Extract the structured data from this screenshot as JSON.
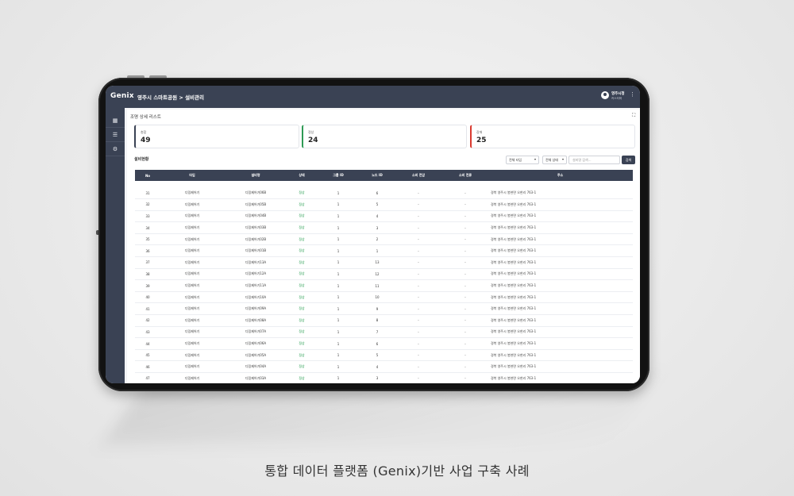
{
  "app": {
    "logo": "Genix",
    "breadcrumb": "영주시 스마트공원 > 설비관리",
    "user_name": "영주시청",
    "user_role": "커스터머"
  },
  "panel": {
    "title": "조명 상세 리스트"
  },
  "stats": [
    {
      "label": "총합",
      "value": "49",
      "color": "#3a4254"
    },
    {
      "label": "정상",
      "value": "24",
      "color": "#2e9a55"
    },
    {
      "label": "장애",
      "value": "25",
      "color": "#d9392f"
    }
  ],
  "section": {
    "title": "설비현황"
  },
  "filters": {
    "type_select": "전체 타입",
    "status_select": "전체 상태",
    "search_placeholder": "설비명 검색...",
    "search_button": "검색"
  },
  "table": {
    "columns": [
      "No",
      "타입",
      "설비명",
      "상태",
      "그룹 ID",
      "노드 ID",
      "소비 전압",
      "소비 전류",
      "주소"
    ],
    "rows": [
      [
        "31",
        "디밍제어기",
        "디밍제어기06B",
        "정상",
        "1",
        "6",
        "-",
        "-",
        "경북 영주시 봉현면 오현리 763-1"
      ],
      [
        "32",
        "디밍제어기",
        "디밍제어기05B",
        "정상",
        "1",
        "5",
        "-",
        "-",
        "경북 영주시 봉현면 오현리 763-1"
      ],
      [
        "33",
        "디밍제어기",
        "디밍제어기04B",
        "정상",
        "1",
        "4",
        "-",
        "-",
        "경북 영주시 봉현면 오현리 763-1"
      ],
      [
        "34",
        "디밍제어기",
        "디밍제어기03B",
        "정상",
        "1",
        "3",
        "-",
        "-",
        "경북 영주시 봉현면 오현리 763-1"
      ],
      [
        "35",
        "디밍제어기",
        "디밍제어기02B",
        "정상",
        "1",
        "2",
        "-",
        "-",
        "경북 영주시 봉현면 오현리 763-1"
      ],
      [
        "36",
        "디밍제어기",
        "디밍제어기01B",
        "정상",
        "1",
        "1",
        "-",
        "-",
        "경북 영주시 봉현면 오현리 763-1"
      ],
      [
        "37",
        "디밍제어기",
        "디밍제어기13A",
        "정상",
        "1",
        "13",
        "-",
        "-",
        "경북 영주시 봉현면 오현리 763-1"
      ],
      [
        "38",
        "디밍제어기",
        "디밍제어기12A",
        "정상",
        "1",
        "12",
        "-",
        "-",
        "경북 영주시 봉현면 오현리 763-1"
      ],
      [
        "39",
        "디밍제어기",
        "디밍제어기11A",
        "정상",
        "1",
        "11",
        "-",
        "-",
        "경북 영주시 봉현면 오현리 763-1"
      ],
      [
        "40",
        "디밍제어기",
        "디밍제어기10A",
        "정상",
        "1",
        "10",
        "-",
        "-",
        "경북 영주시 봉현면 오현리 763-1"
      ],
      [
        "41",
        "디밍제어기",
        "디밍제어기09A",
        "정상",
        "1",
        "9",
        "-",
        "-",
        "경북 영주시 봉현면 오현리 763-1"
      ],
      [
        "42",
        "디밍제어기",
        "디밍제어기08A",
        "정상",
        "1",
        "8",
        "-",
        "-",
        "경북 영주시 봉현면 오현리 763-1"
      ],
      [
        "43",
        "디밍제어기",
        "디밍제어기07A",
        "정상",
        "1",
        "7",
        "-",
        "-",
        "경북 영주시 봉현면 오현리 763-1"
      ],
      [
        "44",
        "디밍제어기",
        "디밍제어기06A",
        "정상",
        "1",
        "6",
        "-",
        "-",
        "경북 영주시 봉현면 오현리 763-1"
      ],
      [
        "45",
        "디밍제어기",
        "디밍제어기05A",
        "정상",
        "1",
        "5",
        "-",
        "-",
        "경북 영주시 봉현면 오현리 763-1"
      ],
      [
        "46",
        "디밍제어기",
        "디밍제어기04A",
        "정상",
        "1",
        "4",
        "-",
        "-",
        "경북 영주시 봉현면 오현리 763-1"
      ],
      [
        "47",
        "디밍제어기",
        "디밍제어기03A",
        "정상",
        "1",
        "3",
        "-",
        "-",
        "경북 영주시 봉현면 오현리 763-1"
      ]
    ]
  },
  "icons": {
    "sidebar": [
      "dashboard-icon",
      "list-icon",
      "settings-icon"
    ],
    "expand": "fullscreen-icon"
  },
  "caption": "통합 데이터 플랫폼 (Genix)기반 사업 구축 사례"
}
